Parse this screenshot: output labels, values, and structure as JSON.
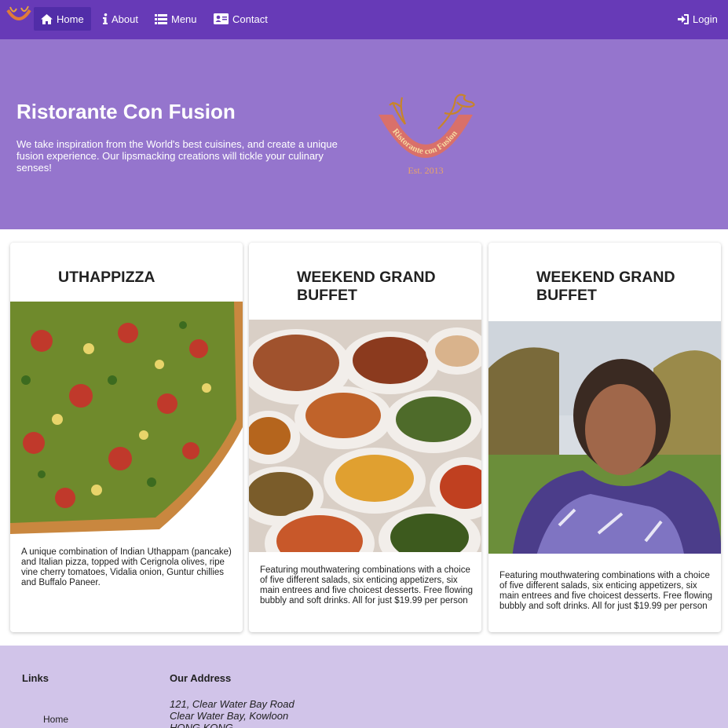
{
  "navbar": {
    "items": [
      {
        "label": "Home",
        "icon": "home-icon",
        "active": true
      },
      {
        "label": "About",
        "icon": "info-icon",
        "active": false
      },
      {
        "label": "Menu",
        "icon": "list-icon",
        "active": false
      },
      {
        "label": "Contact",
        "icon": "address-card-icon",
        "active": false
      }
    ],
    "login": {
      "label": "Login",
      "icon": "sign-in-icon"
    }
  },
  "hero": {
    "title": "Ristorante Con Fusion",
    "description": "We take inspiration from the World's best cuisines, and create a unique fusion experience. Our lipsmacking creations will tickle your culinary senses!",
    "logo_text": "Ristorante con Fusion",
    "logo_est": "Est. 2013"
  },
  "cards": [
    {
      "title": "Uthappizza",
      "text": "A unique combination of Indian Uthappam (pancake) and Italian pizza, topped with Cerignola olives, ripe vine cherry tomatoes, Vidalia onion, Guntur chillies and Buffalo Paneer."
    },
    {
      "title": "Weekend Grand Buffet",
      "text": "Featuring mouthwatering combinations with a choice of five different salads, six enticing appetizers, six main entrees and five choicest desserts. Free flowing bubbly and soft drinks. All for just $19.99 per person"
    },
    {
      "title": "Weekend Grand Buffet",
      "text": "Featuring mouthwatering combinations with a choice of five different salads, six enticing appetizers, six main entrees and five choicest desserts. Free flowing bubbly and soft drinks. All for just $19.99 per person"
    }
  ],
  "footer": {
    "links_heading": "Links",
    "links": [
      "Home"
    ],
    "address_heading": "Our Address",
    "address": [
      "121, Clear Water Bay Road",
      "Clear Water Bay, Kowloon",
      "HONG KONG"
    ]
  },
  "colors": {
    "navbar": "#673ab7",
    "navbar_active": "#512da8",
    "hero": "#9575cd",
    "footer": "#d1c4e9"
  }
}
